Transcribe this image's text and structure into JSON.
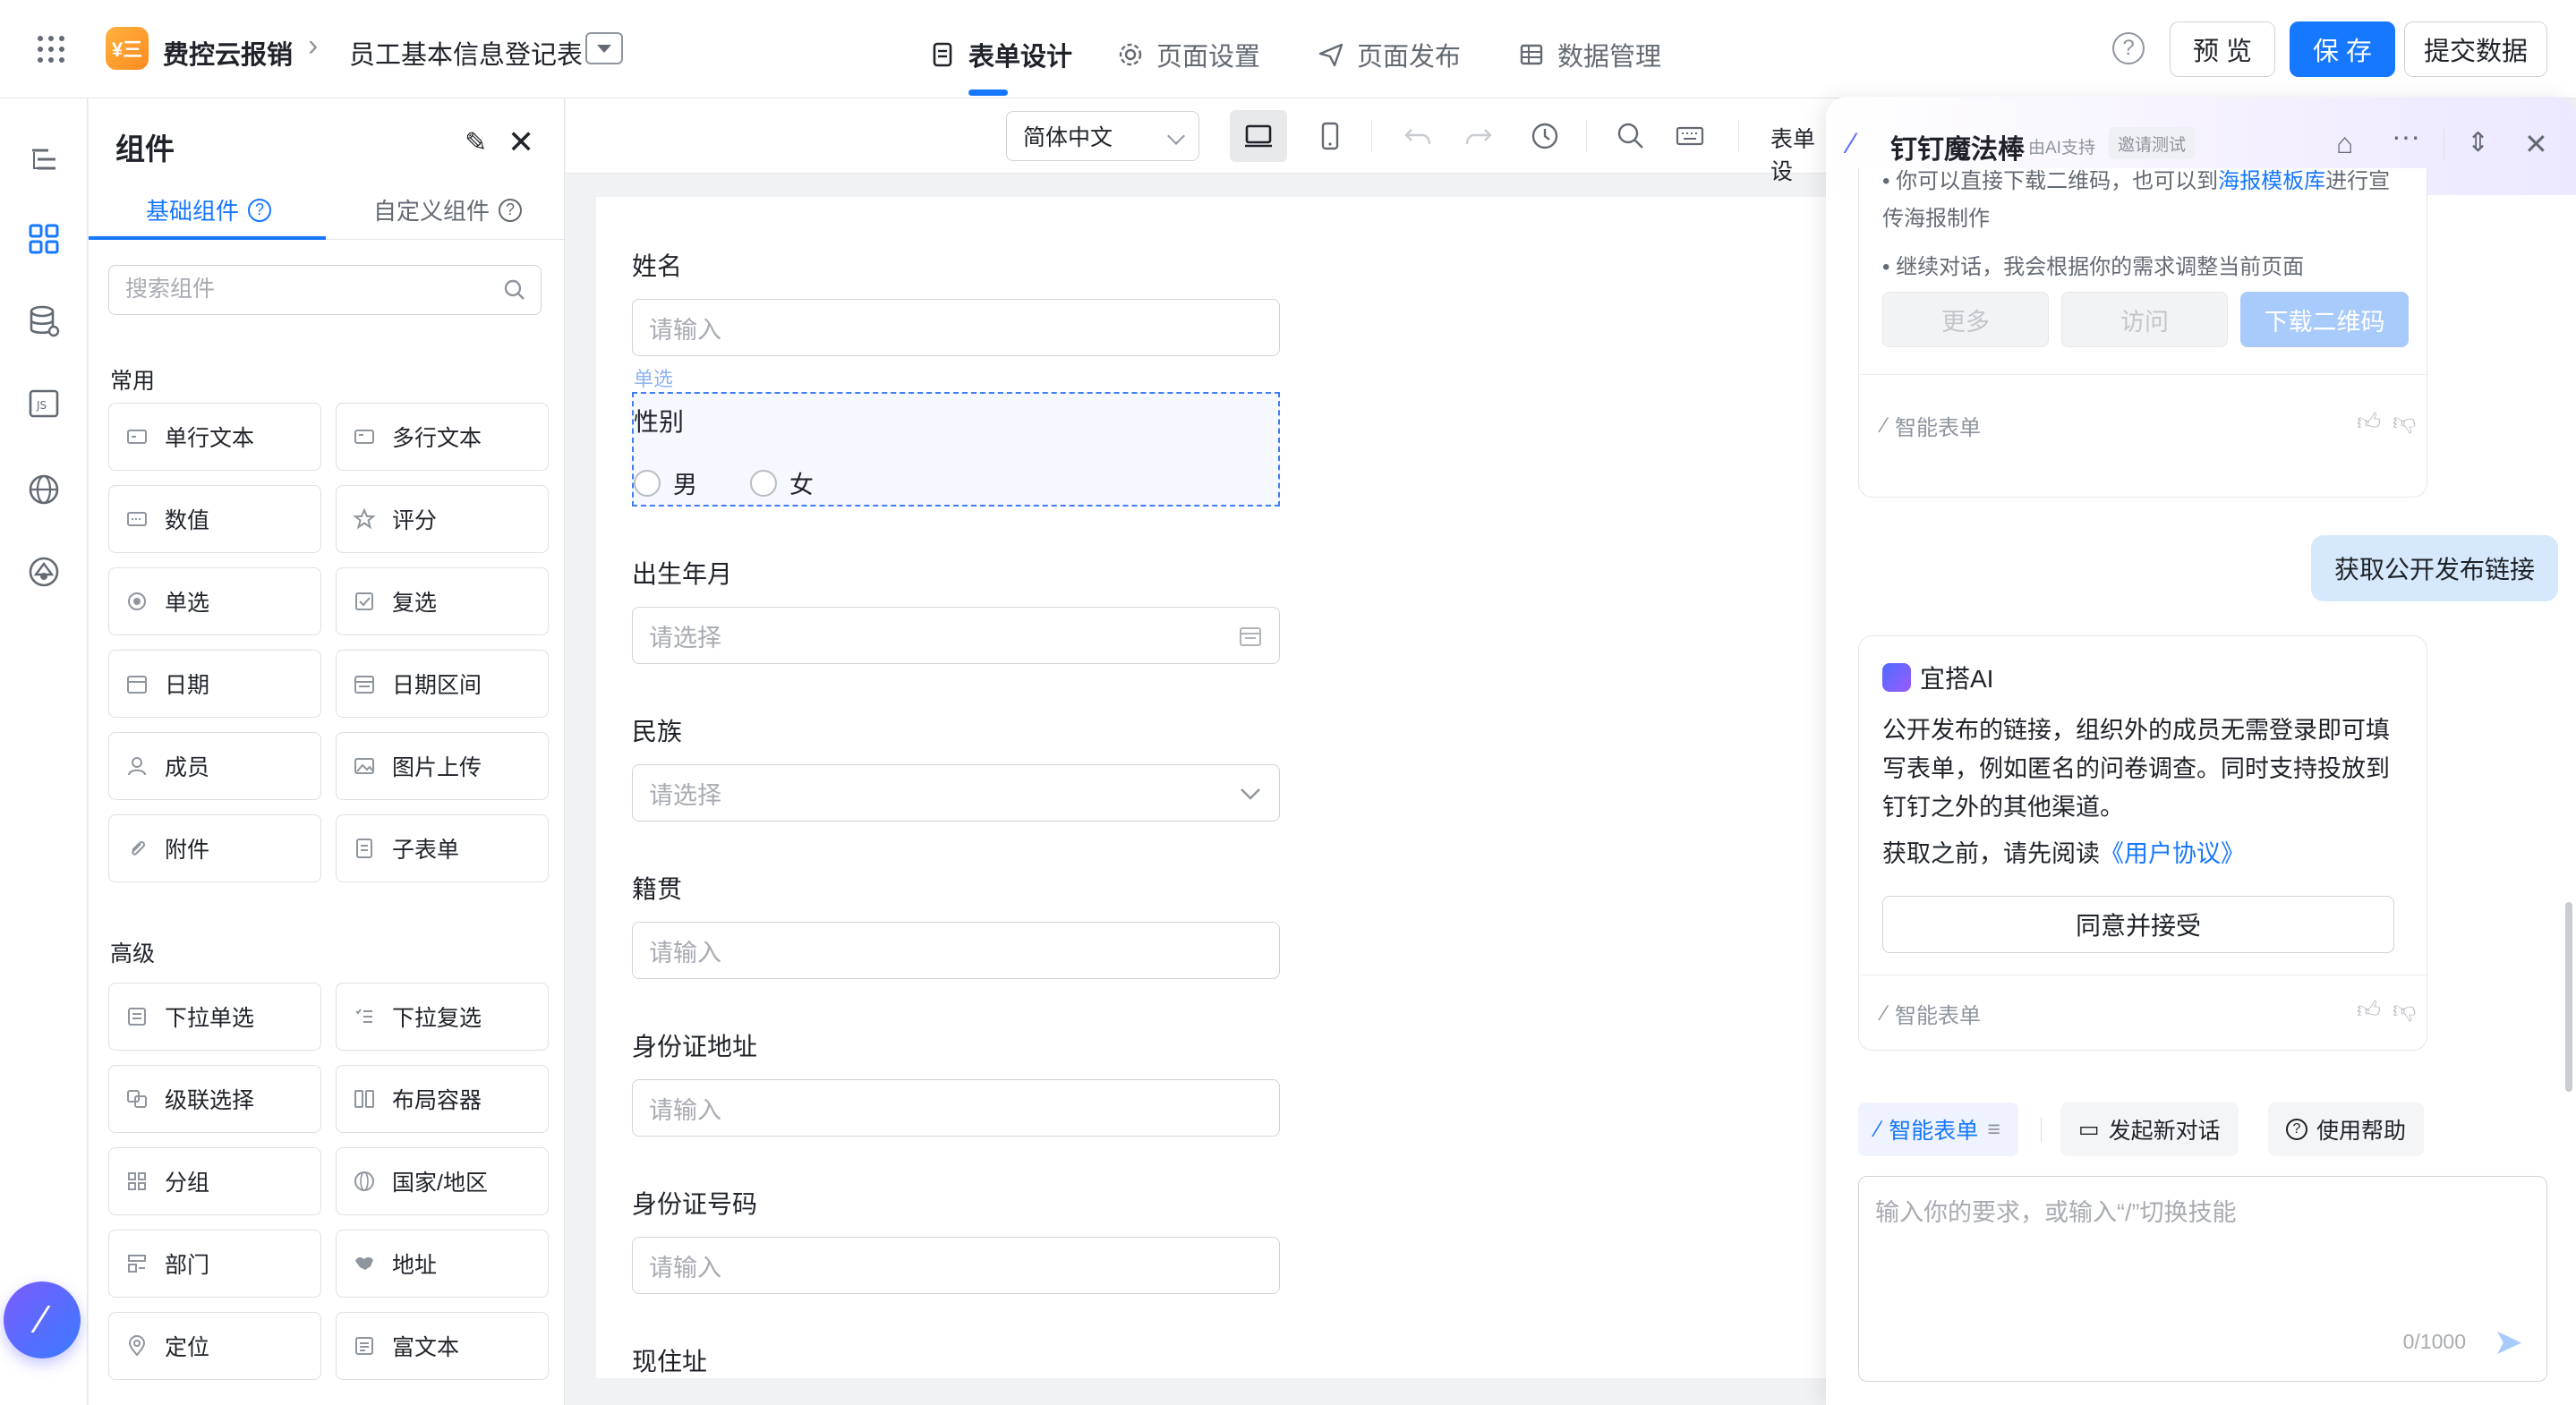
{
  "topbar": {
    "app_logo": "¥三",
    "app_name": "费控云报销",
    "breadcrumb_sep": "›",
    "form_name": "员工基本信息登记表",
    "tabs": [
      {
        "label": "表单设计",
        "icon": "form-design-icon",
        "active": true
      },
      {
        "label": "页面设置",
        "icon": "gear-icon",
        "active": false
      },
      {
        "label": "页面发布",
        "icon": "send-icon",
        "active": false
      },
      {
        "label": "数据管理",
        "icon": "table-icon",
        "active": false
      }
    ],
    "help": "?",
    "preview_label": "预 览",
    "save_label": "保 存",
    "submit_label": "提交数据"
  },
  "panel": {
    "title": "组件",
    "tabs": [
      {
        "label": "基础组件",
        "active": true
      },
      {
        "label": "自定义组件",
        "active": false
      }
    ],
    "search_placeholder": "搜索组件",
    "groups": [
      {
        "title": "常用",
        "items": [
          {
            "label": "单行文本",
            "icon": "single-line-text-icon"
          },
          {
            "label": "多行文本",
            "icon": "multi-line-text-icon"
          },
          {
            "label": "数值",
            "icon": "number-icon"
          },
          {
            "label": "评分",
            "icon": "star-icon"
          },
          {
            "label": "单选",
            "icon": "radio-icon"
          },
          {
            "label": "复选",
            "icon": "checkbox-icon"
          },
          {
            "label": "日期",
            "icon": "calendar-icon"
          },
          {
            "label": "日期区间",
            "icon": "date-range-icon"
          },
          {
            "label": "成员",
            "icon": "user-icon"
          },
          {
            "label": "图片上传",
            "icon": "image-icon"
          },
          {
            "label": "附件",
            "icon": "paperclip-icon"
          },
          {
            "label": "子表单",
            "icon": "subform-icon"
          }
        ]
      },
      {
        "title": "高级",
        "items": [
          {
            "label": "下拉单选",
            "icon": "dropdown-single-icon"
          },
          {
            "label": "下拉复选",
            "icon": "dropdown-multi-icon"
          },
          {
            "label": "级联选择",
            "icon": "cascade-icon"
          },
          {
            "label": "布局容器",
            "icon": "layout-icon"
          },
          {
            "label": "分组",
            "icon": "group-icon"
          },
          {
            "label": "国家/地区",
            "icon": "globe-icon"
          },
          {
            "label": "部门",
            "icon": "department-icon"
          },
          {
            "label": "地址",
            "icon": "map-icon"
          },
          {
            "label": "定位",
            "icon": "location-pin-icon"
          },
          {
            "label": "富文本",
            "icon": "rich-text-icon"
          }
        ]
      }
    ]
  },
  "canvas": {
    "language": "简体中文",
    "toolbar_cut_text": "表单设",
    "selected_tag": "单选",
    "fields": [
      {
        "label": "姓名",
        "placeholder": "请输入",
        "kind": "input"
      },
      {
        "label": "性别",
        "kind": "radio",
        "options": [
          "男",
          "女"
        ]
      },
      {
        "label": "出生年月",
        "placeholder": "请选择",
        "kind": "date"
      },
      {
        "label": "民族",
        "placeholder": "请选择",
        "kind": "select"
      },
      {
        "label": "籍贯",
        "placeholder": "请输入",
        "kind": "input"
      },
      {
        "label": "身份证地址",
        "placeholder": "请输入",
        "kind": "input"
      },
      {
        "label": "身份证号码",
        "placeholder": "请输入",
        "kind": "input"
      },
      {
        "label": "现住址",
        "kind": "input"
      }
    ]
  },
  "ai": {
    "title": "钉钉魔法棒",
    "subtitle": "由AI支持",
    "badge": "邀请测试",
    "prev_card": {
      "line1": "传海报制作",
      "line1_top": "• 你可以直接下载二维码，也可以到",
      "line1_link": "海报模板库",
      "line1_tail": "进行宣",
      "line2": "• 继续对话，我会根据你的需求调整当前页面",
      "buttons": [
        "更多",
        "访问",
        "下载二维码"
      ],
      "footer": "智能表单"
    },
    "user_msg": "获取公开发布链接",
    "answer": {
      "bot_name": "宜搭AI",
      "paragraph": "公开发布的链接，组织外的成员无需登录即可填写表单，例如匿名的问卷调查。同时支持投放到钉钉之外的其他渠道。",
      "read_prefix": "获取之前，请先阅读",
      "read_link": "《用户协议》",
      "agree_button": "同意并接受",
      "footer": "智能表单"
    },
    "skills": [
      {
        "label": "智能表单",
        "icon": "wand-icon",
        "active": true
      },
      {
        "label": "发起新对话",
        "icon": "chat-bubble-icon",
        "active": false
      },
      {
        "label": "使用帮助",
        "icon": "help-icon",
        "active": false
      }
    ],
    "input_placeholder": "输入你的要求，或输入“/”切换技能",
    "counter": "0/1000"
  }
}
